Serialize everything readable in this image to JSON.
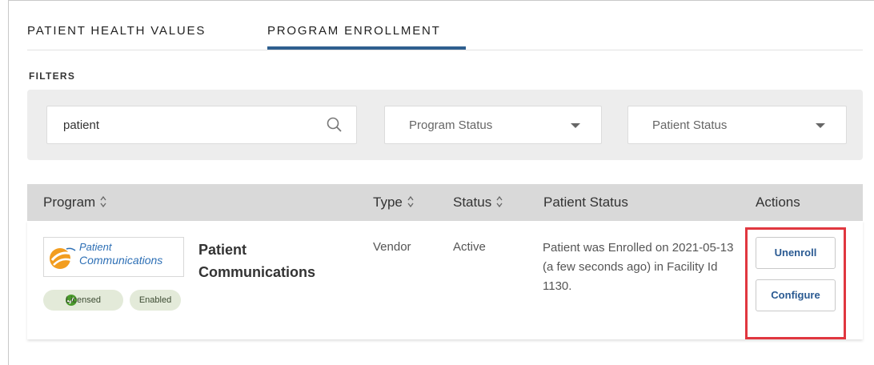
{
  "tabs": [
    {
      "label": "PATIENT HEALTH VALUES"
    },
    {
      "label": "PROGRAM ENROLLMENT"
    }
  ],
  "filters": {
    "label": "FILTERS",
    "search_value": "patient",
    "program_status_placeholder": "Program Status",
    "patient_status_placeholder": "Patient Status"
  },
  "table": {
    "headers": {
      "program": "Program",
      "type": "Type",
      "status": "Status",
      "patient_status": "Patient Status",
      "actions": "Actions"
    },
    "rows": [
      {
        "logo_line1": "Patient",
        "logo_line2": "Communications",
        "badge_licensed": "Licensed",
        "badge_enabled": "Enabled",
        "name": "Patient Communications",
        "type": "Vendor",
        "status": "Active",
        "patient_status": "Patient was Enrolled on 2021-05-13 (a few seconds ago) in Facility Id 1130.",
        "unenroll_label": "Unenroll",
        "configure_label": "Configure"
      }
    ]
  },
  "colors": {
    "active_tab": "#2f5f8f",
    "highlight_box": "#e0373f",
    "action_text": "#2a5a92",
    "badge_check": "#4a9a2c"
  },
  "icons": {
    "search": "search-icon",
    "dropdown": "chevron-down-icon",
    "sort": "sort-icon",
    "check": "check-circle-icon"
  }
}
